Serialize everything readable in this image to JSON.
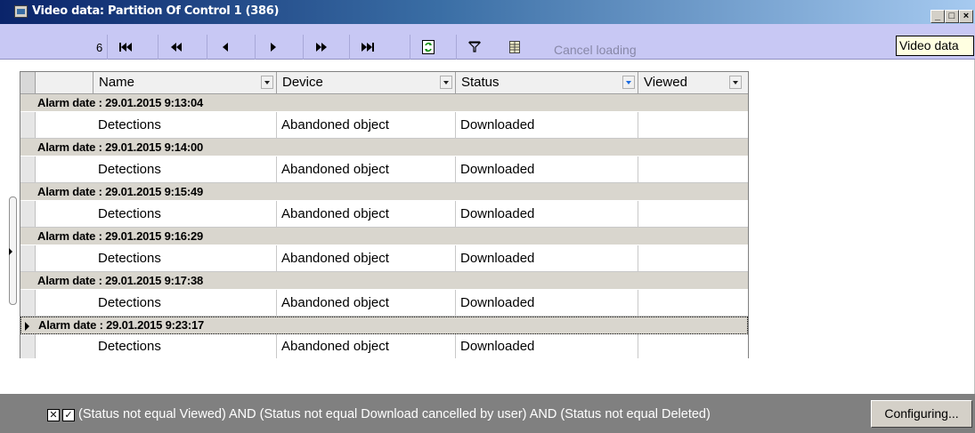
{
  "window": {
    "title": "Video data: Partition  Of Control 1 (386)",
    "controls": [
      "_",
      "□",
      "×"
    ]
  },
  "toolbar": {
    "record_number": "6",
    "cancel_loading_label": "Cancel loading",
    "buttons": [
      "first-record",
      "previous-page",
      "previous-record",
      "next-record",
      "next-page",
      "last-record",
      "refresh",
      "filter",
      "columns"
    ]
  },
  "tooltip": {
    "text": "Video data"
  },
  "grid": {
    "columns": [
      {
        "label": "Name"
      },
      {
        "label": "Device"
      },
      {
        "label": "Status"
      },
      {
        "label": "Viewed"
      }
    ],
    "groups": [
      {
        "header": "Alarm date : 29.01.2015 9:13:04",
        "row": {
          "name": "Detections",
          "device": "Abandoned object",
          "status": "Downloaded",
          "viewed": ""
        }
      },
      {
        "header": "Alarm date : 29.01.2015 9:14:00",
        "row": {
          "name": "Detections",
          "device": "Abandoned object",
          "status": "Downloaded",
          "viewed": ""
        }
      },
      {
        "header": "Alarm date : 29.01.2015 9:15:49",
        "row": {
          "name": "Detections",
          "device": "Abandoned object",
          "status": "Downloaded",
          "viewed": ""
        }
      },
      {
        "header": "Alarm date : 29.01.2015 9:16:29",
        "row": {
          "name": "Detections",
          "device": "Abandoned object",
          "status": "Downloaded",
          "viewed": ""
        }
      },
      {
        "header": "Alarm date : 29.01.2015 9:17:38",
        "row": {
          "name": "Detections",
          "device": "Abandoned object",
          "status": "Downloaded",
          "viewed": ""
        }
      },
      {
        "header": "Alarm date : 29.01.2015 9:23:17",
        "row": {
          "name": "Detections",
          "device": "Abandoned object",
          "status": "Downloaded",
          "viewed": ""
        }
      }
    ]
  },
  "filter": {
    "text": "(Status not equal Viewed) AND (Status not equal Download cancelled by user) AND (Status not equal Deleted)",
    "clear_glyph": "✕",
    "enabled_glyph": "✓",
    "configure_label": "Configuring..."
  },
  "colors": {
    "title_gradient_start": "#0a246a",
    "toolbar_bg": "#c8c8f4",
    "group_row_bg": "#d9d6ce",
    "filter_bar_bg": "#808080"
  }
}
